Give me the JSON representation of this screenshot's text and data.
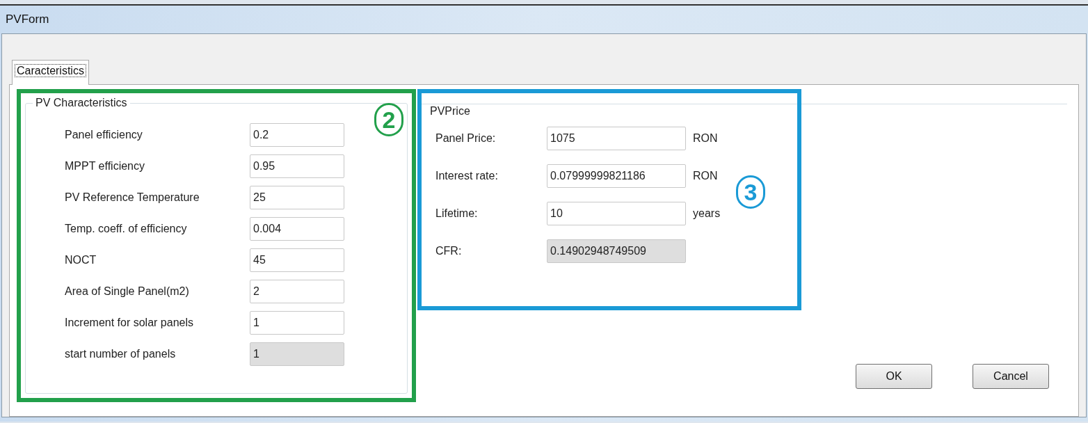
{
  "window": {
    "title": "PVForm"
  },
  "tabs": [
    {
      "label": "Caracteristics",
      "selected": true
    }
  ],
  "groups": [
    {
      "title": "PV Characteristics",
      "annotation": {
        "mark": "2",
        "color": "#22a04b"
      },
      "fields": [
        {
          "label": "Panel efficiency",
          "value": "0.2",
          "disabled": false
        },
        {
          "label": "MPPT efficiency",
          "value": "0.95",
          "disabled": false
        },
        {
          "label": "PV Reference Temperature",
          "value": "25",
          "disabled": false
        },
        {
          "label": "Temp. coeff. of efficiency",
          "value": "0.004",
          "disabled": false
        },
        {
          "label": "NOCT",
          "value": "45",
          "disabled": false
        },
        {
          "label": "Area of Single Panel(m2)",
          "value": "2",
          "disabled": false
        },
        {
          "label": "Increment for solar panels",
          "value": "1",
          "disabled": false
        },
        {
          "label": "start number of panels",
          "value": "1",
          "disabled": true
        }
      ]
    },
    {
      "title": "PVPrice",
      "annotation": {
        "mark": "3",
        "color": "#1a9ad6"
      },
      "fields": [
        {
          "label": "Panel Price:",
          "value": "1075",
          "unit": "RON",
          "disabled": false
        },
        {
          "label": "Interest rate:",
          "value": "0.07999999821186",
          "unit": "RON",
          "disabled": false
        },
        {
          "label": "Lifetime:",
          "value": "10",
          "unit": "years",
          "disabled": false
        },
        {
          "label": "CFR:",
          "value": "0.14902948749509",
          "disabled": true
        }
      ]
    }
  ],
  "buttons": [
    "OK",
    "Cancel"
  ]
}
